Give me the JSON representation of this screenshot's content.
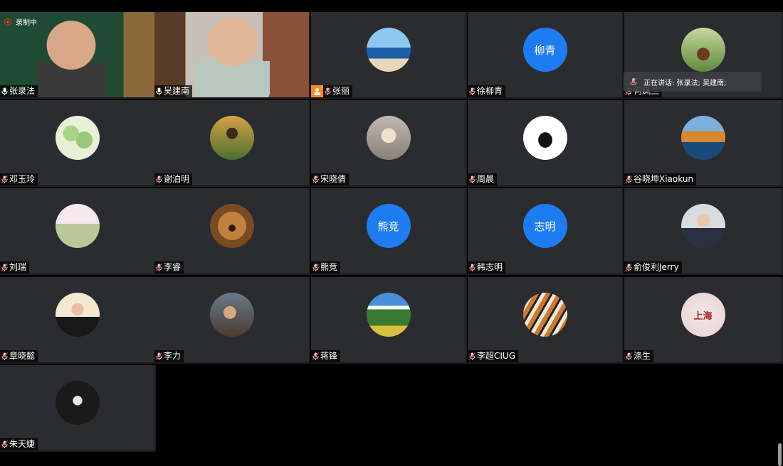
{
  "recording": {
    "label": "录制中"
  },
  "speaking": {
    "label": "正在讲话: 张录法; 吴建南;"
  },
  "participants": [
    {
      "name": "张录法",
      "avatar_type": "video",
      "avatar_icon": "video-feed-classroom",
      "mic": "active"
    },
    {
      "name": "吴建南",
      "avatar_type": "video",
      "avatar_icon": "video-feed-bookshelf",
      "mic": "active"
    },
    {
      "name": "张丽",
      "avatar_type": "image",
      "avatar_icon": "beach-photo-avatar",
      "mic": "muted",
      "host": true
    },
    {
      "name": "徐柳青",
      "avatar_type": "text",
      "avatar_text": "柳青",
      "mic": "muted"
    },
    {
      "name": "何凤兰",
      "avatar_type": "image",
      "avatar_icon": "horse-rider-avatar",
      "mic": "muted"
    },
    {
      "name": "邓玉玲",
      "avatar_type": "image",
      "avatar_icon": "ice-cream-avatar",
      "mic": "muted"
    },
    {
      "name": "谢泊明",
      "avatar_type": "image",
      "avatar_icon": "person-outdoor-avatar",
      "mic": "muted"
    },
    {
      "name": "宋晓倩",
      "avatar_type": "image",
      "avatar_icon": "woman-photo-avatar",
      "mic": "muted"
    },
    {
      "name": "周晨",
      "avatar_type": "image",
      "avatar_icon": "penguin-avatar",
      "mic": "muted"
    },
    {
      "name": "谷晓坤Xiaokun",
      "avatar_type": "image",
      "avatar_icon": "autumn-lake-avatar",
      "mic": "muted"
    },
    {
      "name": "刘瑞",
      "avatar_type": "image",
      "avatar_icon": "park-photo-avatar",
      "mic": "muted"
    },
    {
      "name": "李睿",
      "avatar_type": "image",
      "avatar_icon": "teddy-bear-avatar",
      "mic": "muted"
    },
    {
      "name": "熊竞",
      "avatar_type": "text",
      "avatar_text": "熊竞",
      "mic": "muted"
    },
    {
      "name": "韩志明",
      "avatar_type": "text",
      "avatar_text": "志明",
      "mic": "muted"
    },
    {
      "name": "俞俊利Jerry",
      "avatar_type": "image",
      "avatar_icon": "man-suit-avatar",
      "mic": "muted"
    },
    {
      "name": "章晓懿",
      "avatar_type": "image",
      "avatar_icon": "woman-suit-avatar",
      "mic": "muted"
    },
    {
      "name": "李力",
      "avatar_type": "image",
      "avatar_icon": "man-selfie-avatar",
      "mic": "muted"
    },
    {
      "name": "蒋锋",
      "avatar_type": "image",
      "avatar_icon": "mountain-landscape-avatar",
      "mic": "muted"
    },
    {
      "name": "李超CIUG",
      "avatar_type": "image",
      "avatar_icon": "tiger-painting-avatar",
      "mic": "muted"
    },
    {
      "name": "涤生",
      "avatar_type": "image",
      "avatar_icon": "shanghai-word-cloud-avatar",
      "avatar_text": "上海",
      "mic": "muted"
    },
    {
      "name": "朱天婕",
      "avatar_type": "image",
      "avatar_icon": "dark-portrait-avatar",
      "mic": "muted"
    }
  ],
  "colors": {
    "tile_bg": "#2b2c2f",
    "accent_blue": "#1e7cf2",
    "record_red": "#e33333",
    "host_orange": "#ff8a1f",
    "mute_red": "#e03030"
  }
}
